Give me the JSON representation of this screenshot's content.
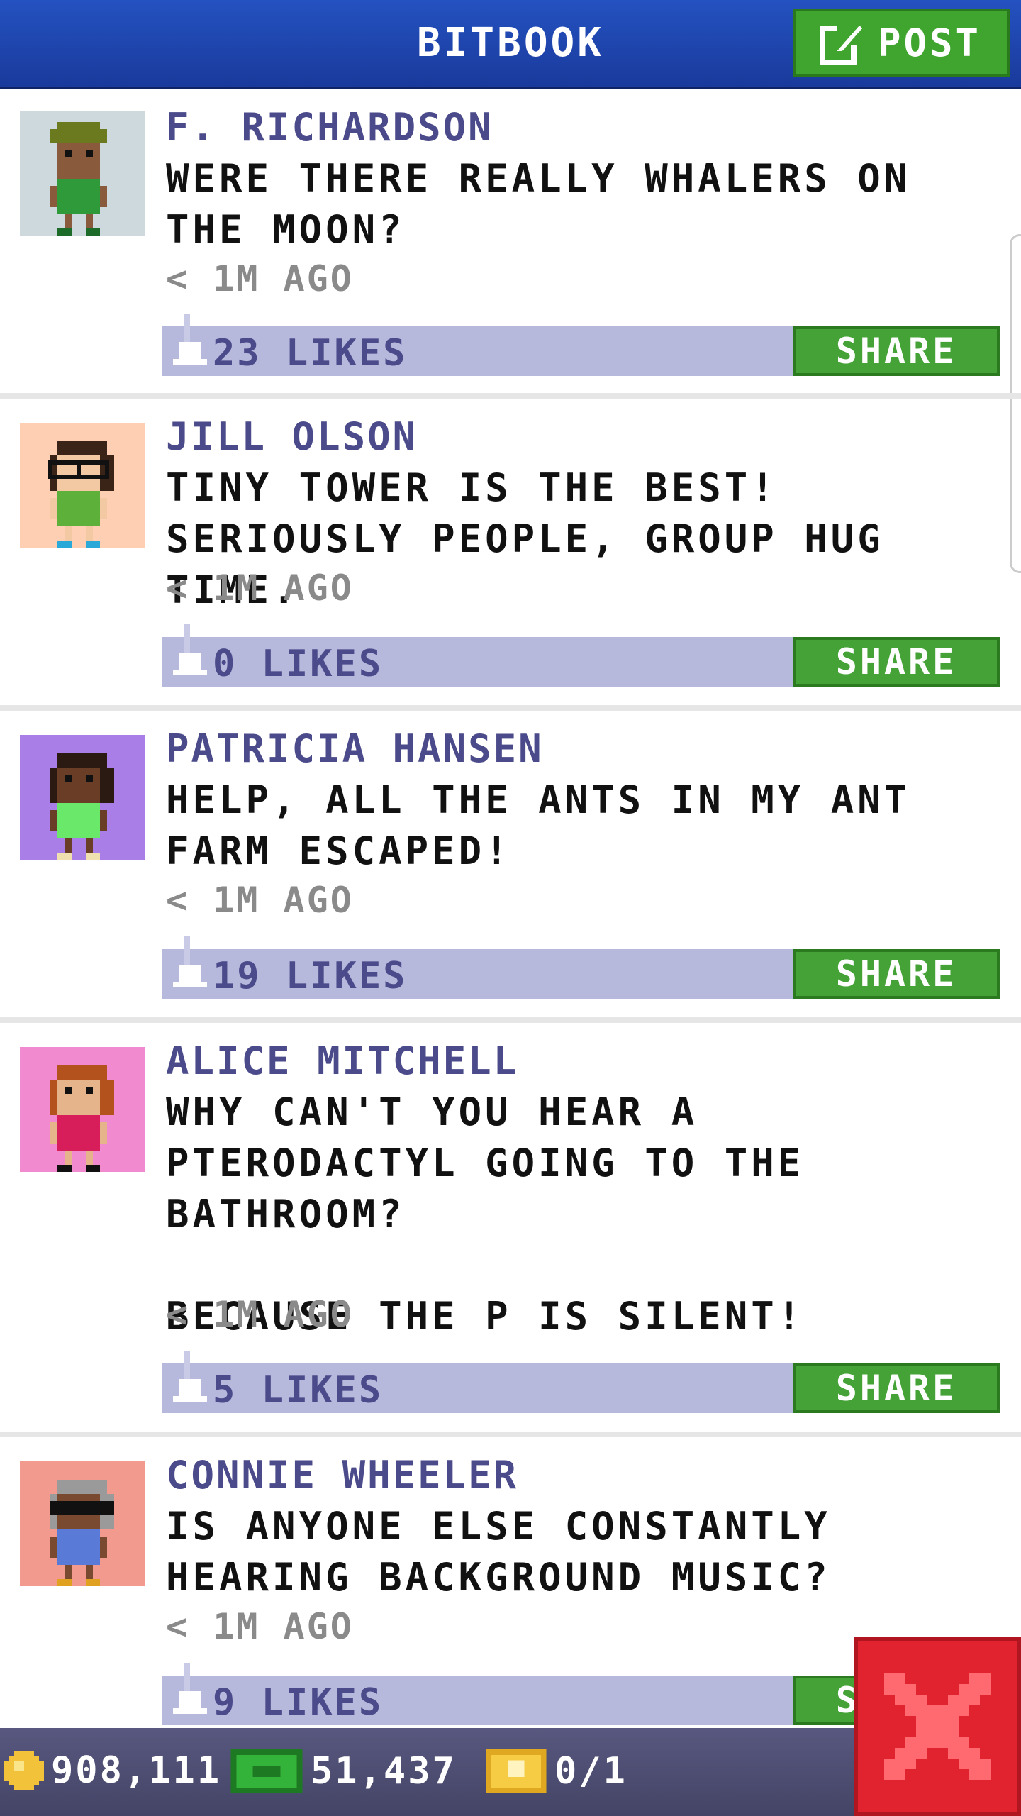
{
  "header": {
    "title": "BITBOOK",
    "post_label": "POST"
  },
  "posts": [
    {
      "name": "F. RICHARDSON",
      "message": "WERE THERE REALLY WHALERS ON THE MOON?",
      "time": "< 1M AGO",
      "likes": "23 LIKES",
      "share": "SHARE",
      "avatar_bg": "#cdd9dd"
    },
    {
      "name": "JILL OLSON",
      "message": "TINY TOWER IS THE BEST! SERIOUSLY PEOPLE, GROUP HUG TIME.",
      "time": "< 1M AGO",
      "likes": "0 LIKES",
      "share": "SHARE",
      "avatar_bg": "#ffcfb4"
    },
    {
      "name": "PATRICIA HANSEN",
      "message": "HELP, ALL THE ANTS IN MY ANT FARM ESCAPED!",
      "time": "< 1M AGO",
      "likes": "19 LIKES",
      "share": "SHARE",
      "avatar_bg": "#a97ee6"
    },
    {
      "name": "ALICE MITCHELL",
      "message": "WHY CAN'T YOU HEAR A PTERODACTYL GOING TO THE BATHROOM?\n\nBECAUSE THE P IS SILENT!",
      "time": "< 1M AGO",
      "likes": "5 LIKES",
      "share": "SHARE",
      "avatar_bg": "#f28ad0"
    },
    {
      "name": "CONNIE WHEELER",
      "message": "IS ANYONE ELSE CONSTANTLY HEARING BACKGROUND MUSIC?",
      "time": "< 1M AGO",
      "likes": "9 LIKES",
      "share": "SHARE",
      "avatar_bg": "#f29a8e"
    }
  ],
  "currency": {
    "coins": "908,111",
    "bux": "51,437",
    "tickets": "0/1"
  },
  "icons": [
    "post-edit-icon",
    "like-thumb-icon",
    "coin-icon",
    "bux-icon",
    "ticket-icon",
    "close-icon"
  ],
  "colors": {
    "header": "#2452c0",
    "share": "#44a236",
    "likebar": "#b6b8dc",
    "close": "#e0232e"
  }
}
